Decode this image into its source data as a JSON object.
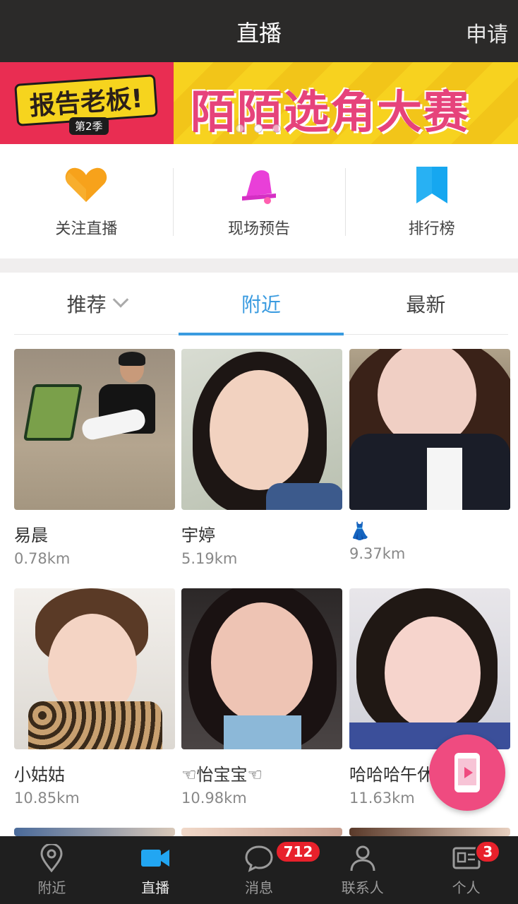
{
  "header": {
    "title": "直播",
    "action": "申请"
  },
  "banner": {
    "left_logo": "报告老板!",
    "left_season": "第2季",
    "main_text": "陌陌选角大赛",
    "dot_count": 3,
    "active_dot": 1
  },
  "shortcuts": [
    {
      "label": "关注直播",
      "icon": "heart-icon",
      "color": "#f7a21b"
    },
    {
      "label": "现场预告",
      "icon": "bell-icon",
      "color": "#e93fd8"
    },
    {
      "label": "排行榜",
      "icon": "bookmark-icon",
      "color": "#16a7f0"
    }
  ],
  "tabs": [
    {
      "label": "推荐",
      "has_dropdown": true,
      "active": false
    },
    {
      "label": "附近",
      "has_dropdown": false,
      "active": true
    },
    {
      "label": "最新",
      "has_dropdown": false,
      "active": false
    }
  ],
  "streamers": [
    {
      "name": "易晨",
      "distance": "0.78km"
    },
    {
      "name": "宇婷",
      "distance": "5.19km"
    },
    {
      "name": "👗",
      "distance": "9.37km"
    },
    {
      "name": "小姑姑",
      "distance": "10.85km"
    },
    {
      "name": "☜怡宝宝☜",
      "distance": "10.98km"
    },
    {
      "name": "哈哈哈午休",
      "distance": "11.63km"
    }
  ],
  "fab": {
    "icon": "phone-live-icon"
  },
  "bottom_nav": [
    {
      "label": "附近",
      "icon": "location-pin-icon",
      "active": false,
      "badge": ""
    },
    {
      "label": "直播",
      "icon": "video-camera-icon",
      "active": true,
      "badge": ""
    },
    {
      "label": "消息",
      "icon": "chat-bubble-icon",
      "active": false,
      "badge": "712"
    },
    {
      "label": "联系人",
      "icon": "person-icon",
      "active": false,
      "badge": ""
    },
    {
      "label": "个人",
      "icon": "profile-card-icon",
      "active": false,
      "badge": "3"
    }
  ],
  "colors": {
    "accent": "#3a9be0",
    "topbar": "#2b2a29",
    "bottombar": "#1f1f1f",
    "badge": "#e8212b",
    "fab": "#ef4b80"
  }
}
